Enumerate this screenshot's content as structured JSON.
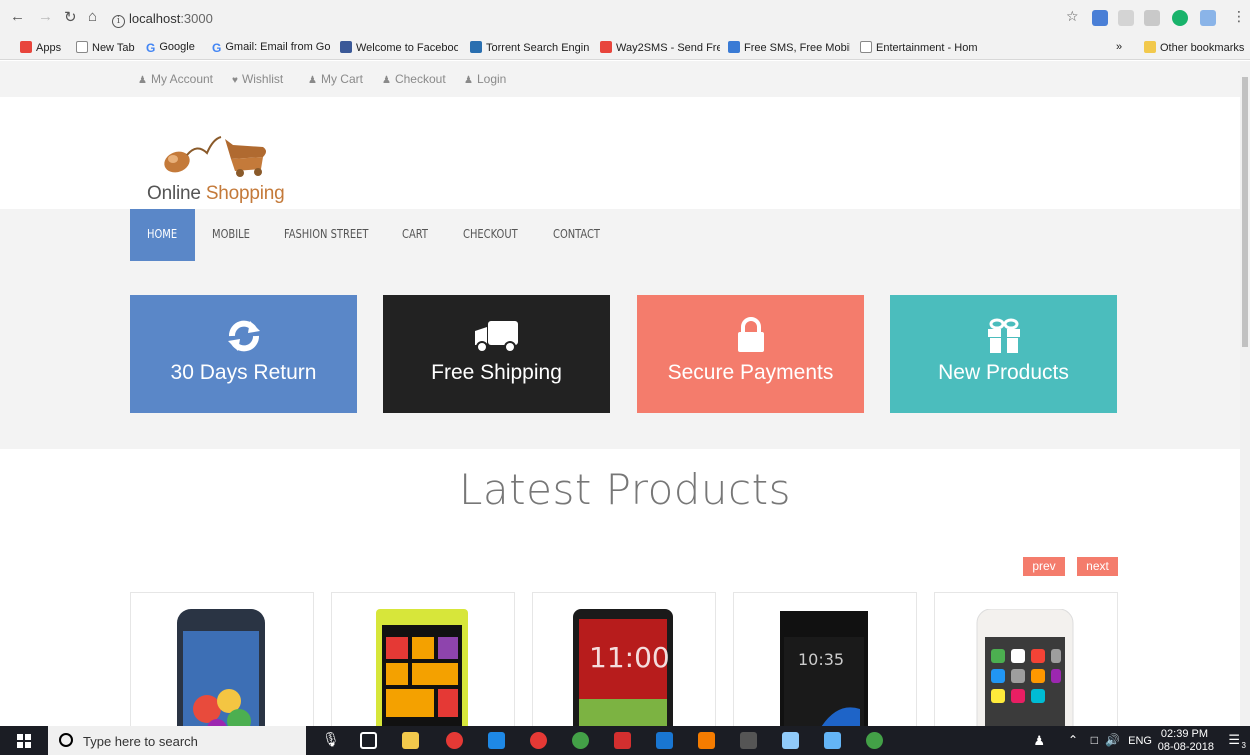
{
  "browser": {
    "url_host": "localhost",
    "url_path": ":3000",
    "bookmarks": [
      {
        "label": "Apps",
        "color": "#e8453c"
      },
      {
        "label": "New Tab",
        "color": "#888888"
      },
      {
        "label": "Google",
        "color": "#4285f4"
      },
      {
        "label": "Gmail: Email from Go",
        "color": "#4285f4"
      },
      {
        "label": "Welcome to Faceboo",
        "color": "#3b5998"
      },
      {
        "label": "Torrent Search Engin",
        "color": "#2a6fb0"
      },
      {
        "label": "Way2SMS - Send Fre",
        "color": "#e8453c"
      },
      {
        "label": "Free SMS, Free Mobil",
        "color": "#3a7bd5"
      },
      {
        "label": "Entertainment - Hom",
        "color": "#888888"
      }
    ],
    "more_label": "»",
    "other_bookmarks": "Other bookmarks"
  },
  "topbar": {
    "links": [
      "My Account",
      "Wishlist",
      "My Cart",
      "Checkout",
      "Login"
    ]
  },
  "logo": {
    "text_online": "Online",
    "text_shopping": "Shopping"
  },
  "nav": {
    "items": [
      "HOME",
      "MOBILE",
      "FASHION STREET",
      "CART",
      "CHECKOUT",
      "CONTACT"
    ],
    "active": "HOME"
  },
  "features": [
    {
      "label": "30 Days Return",
      "icon": "refresh-icon",
      "color": "#5a87c8"
    },
    {
      "label": "Free Shipping",
      "icon": "truck-icon",
      "color": "#222222"
    },
    {
      "label": "Secure Payments",
      "icon": "lock-icon",
      "color": "#f47c6c"
    },
    {
      "label": "New Products",
      "icon": "gift-icon",
      "color": "#4bbdbd"
    }
  ],
  "latest": {
    "title": "Latest Products",
    "prev": "prev",
    "next": "next"
  },
  "taskbar": {
    "search_placeholder": "Type here to search",
    "language": "ENG",
    "time": "02:39 PM",
    "date": "08-08-2018",
    "notifications": "3"
  }
}
